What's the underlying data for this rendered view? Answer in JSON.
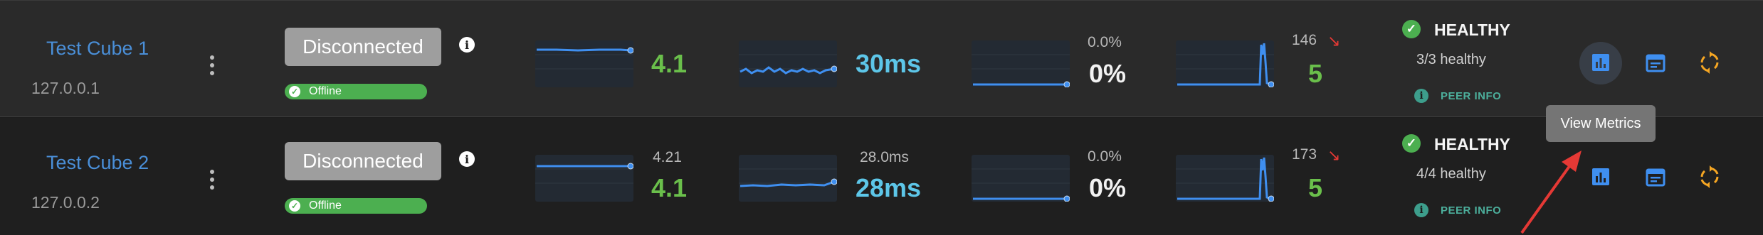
{
  "rows": [
    {
      "name": "Test Cube 1",
      "ip": "127.0.0.1",
      "status_button": "Disconnected",
      "status_badge": "Offline",
      "metric1": {
        "top": "",
        "value": "4.1"
      },
      "metric2": {
        "top": "",
        "value": "30ms"
      },
      "metric3": {
        "top": "0.0%",
        "value": "0%"
      },
      "metric4": {
        "top": "146",
        "value": "5"
      },
      "health": {
        "label": "HEALTHY",
        "count": "3/3 healthy",
        "peer": "PEER INFO"
      }
    },
    {
      "name": "Test Cube 2",
      "ip": "127.0.0.2",
      "status_button": "Disconnected",
      "status_badge": "Offline",
      "metric1": {
        "top": "4.21",
        "value": "4.1"
      },
      "metric2": {
        "top": "28.0ms",
        "value": "28ms"
      },
      "metric3": {
        "top": "0.0%",
        "value": "0%"
      },
      "metric4": {
        "top": "173",
        "value": "5"
      },
      "health": {
        "label": "HEALTHY",
        "count": "4/4 healthy",
        "peer": "PEER INFO"
      }
    }
  ],
  "tooltip": "View Metrics",
  "colors": {
    "accent_blue": "#4a8fd8",
    "green": "#6abf4b",
    "cyan": "#5dc6e8",
    "orange": "#f5a623",
    "red": "#e53935",
    "badge_green": "#4caf50"
  },
  "icons": {
    "info": "info-icon",
    "trend_down": "trend-down-icon",
    "check": "check-circle-icon",
    "metrics": "bar-chart-icon",
    "calendar": "calendar-icon",
    "sync": "sync-icon",
    "more": "more-vert-icon"
  }
}
